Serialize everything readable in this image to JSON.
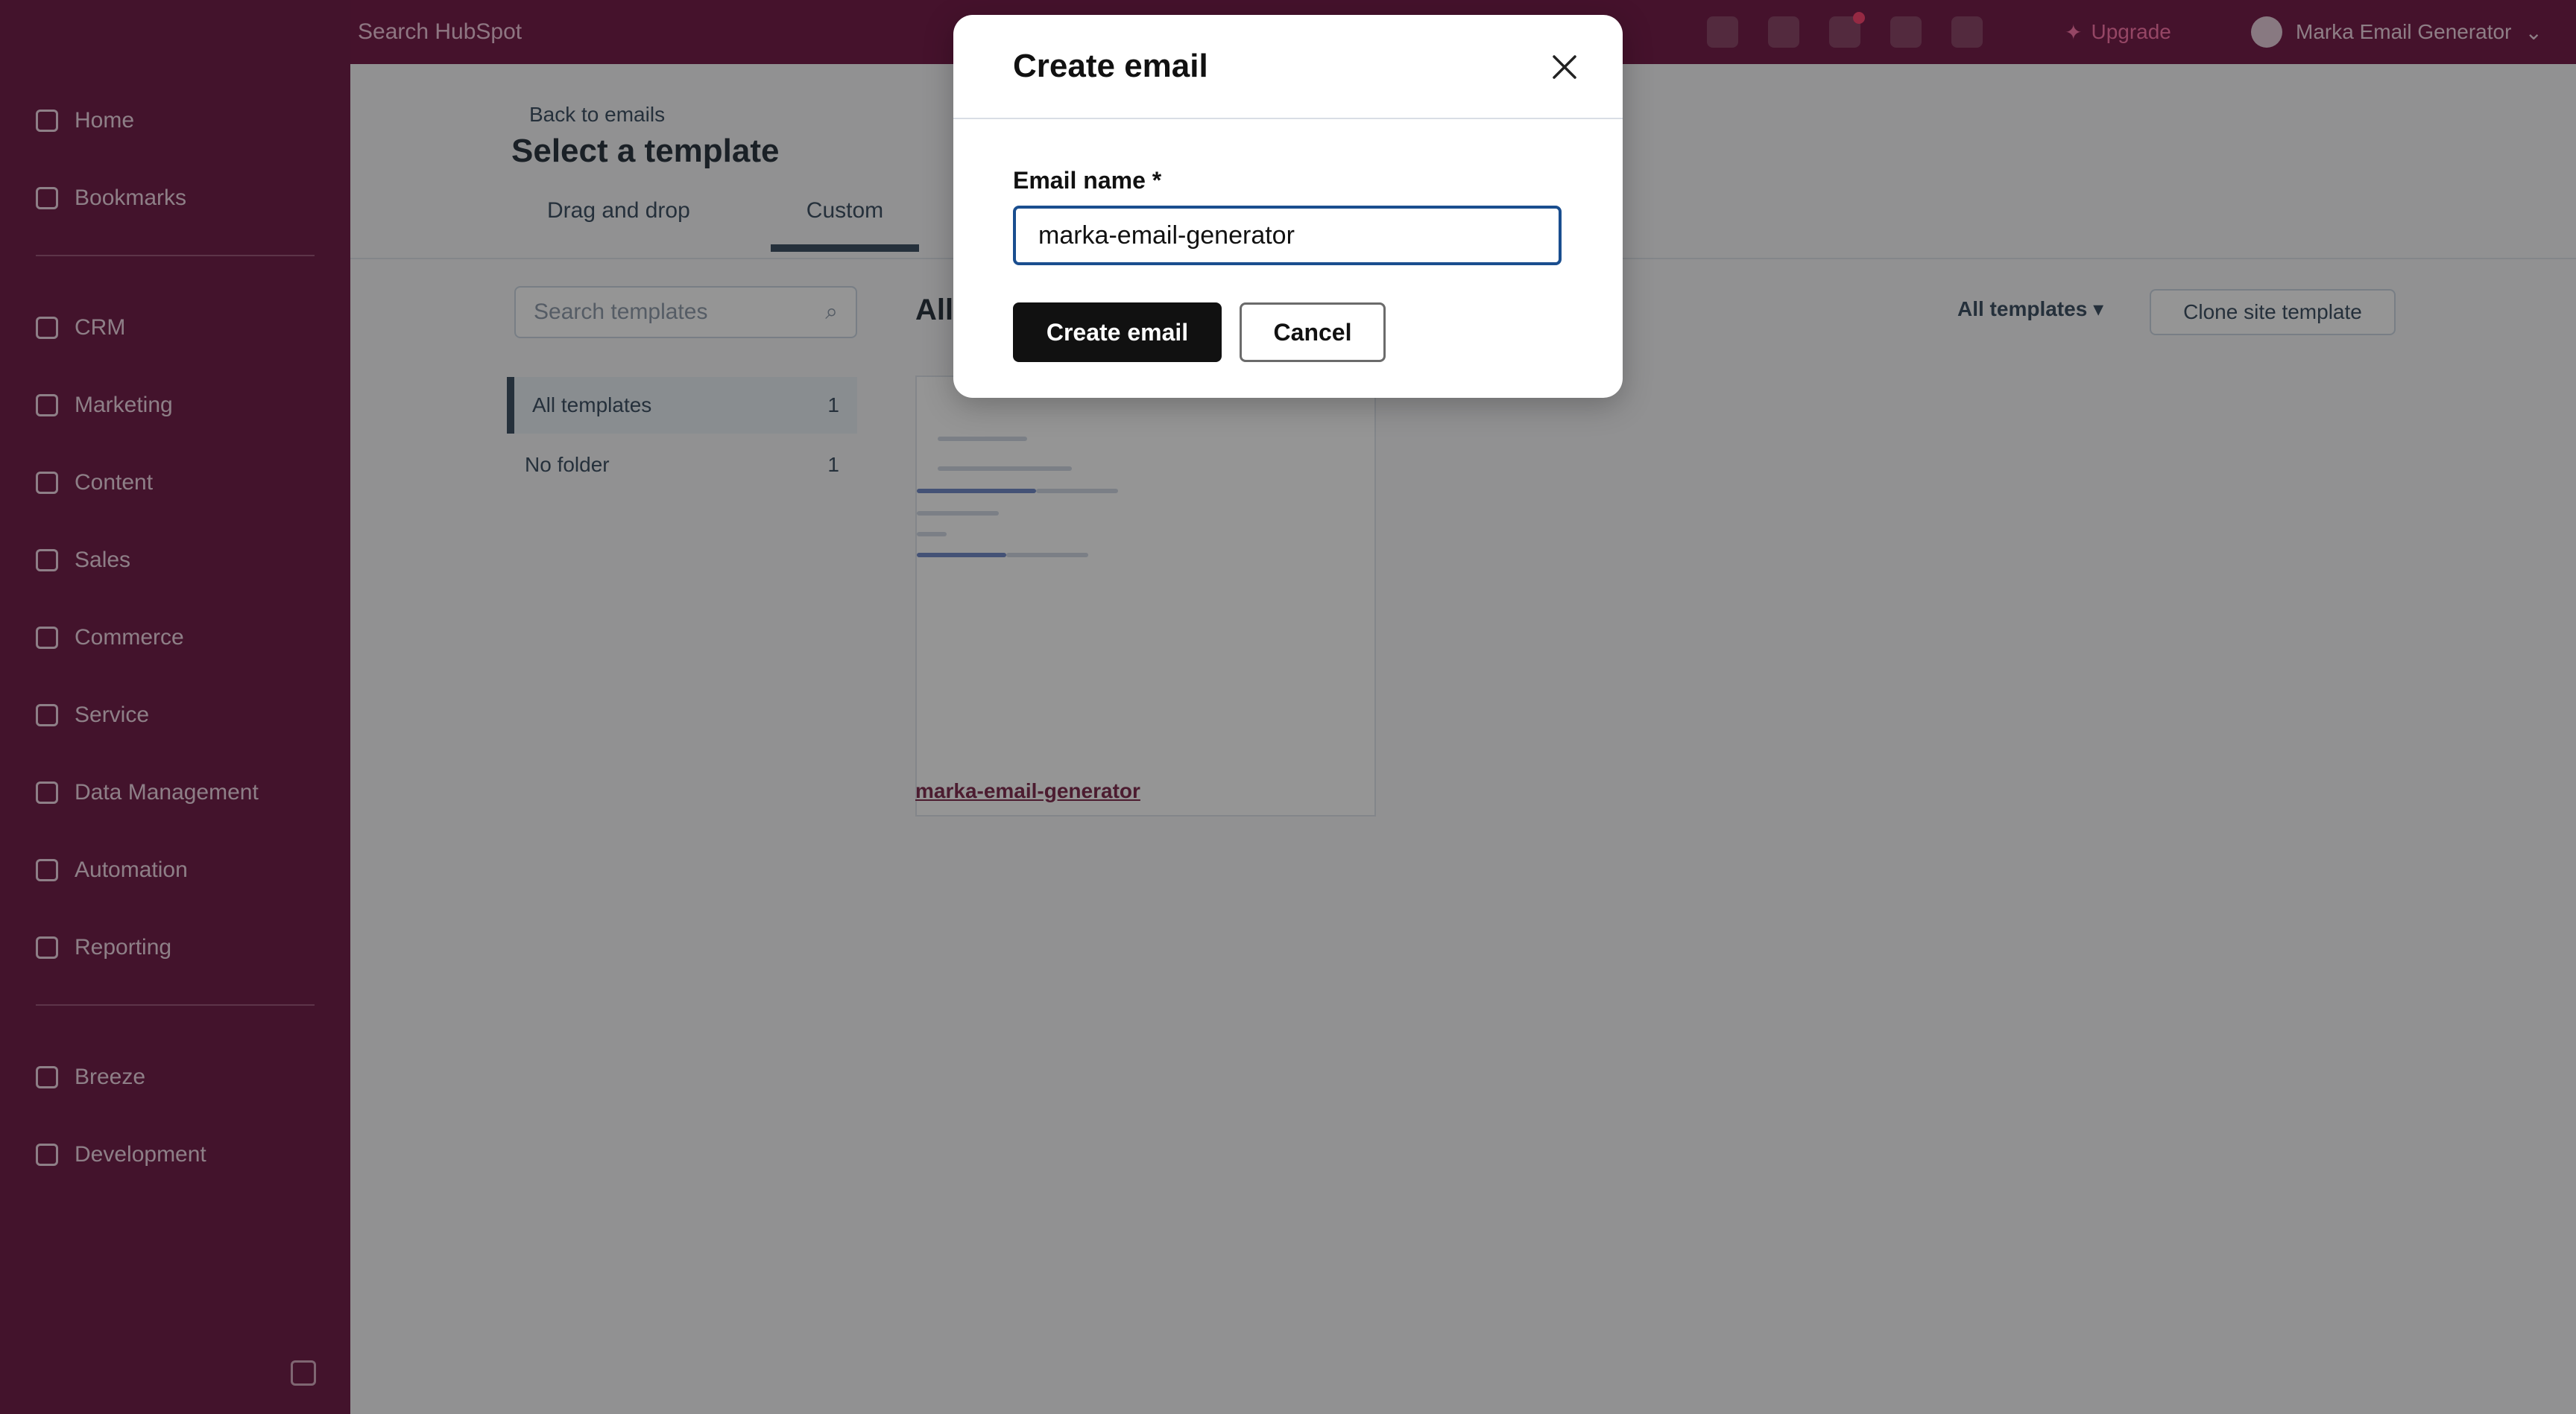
{
  "topbar": {
    "search_placeholder": "Search HubSpot",
    "upgrade_label": "Upgrade",
    "account_name": "Marka Email Generator"
  },
  "sidebar": {
    "items": [
      {
        "label": "Home",
        "icon": "home-icon"
      },
      {
        "label": "Bookmarks",
        "icon": "bookmark-icon"
      },
      {
        "label": "CRM",
        "icon": "crm-icon"
      },
      {
        "label": "Marketing",
        "icon": "marketing-icon"
      },
      {
        "label": "Content",
        "icon": "content-icon"
      },
      {
        "label": "Sales",
        "icon": "sales-icon"
      },
      {
        "label": "Commerce",
        "icon": "commerce-icon"
      },
      {
        "label": "Service",
        "icon": "service-icon"
      },
      {
        "label": "Data Management",
        "icon": "data-icon"
      },
      {
        "label": "Automation",
        "icon": "automation-icon"
      },
      {
        "label": "Reporting",
        "icon": "reporting-icon"
      },
      {
        "label": "Breeze",
        "icon": "breeze-icon"
      },
      {
        "label": "Development",
        "icon": "development-icon"
      }
    ]
  },
  "main": {
    "back_link": "Back to emails",
    "title": "Select a template",
    "tabs": [
      "Drag and drop",
      "Custom"
    ],
    "search_placeholder": "Search templates",
    "categories": [
      {
        "label": "All templates",
        "count": "1"
      },
      {
        "label": "No folder",
        "count": "1"
      }
    ],
    "heading": "All",
    "filter_label": "All templates",
    "import_label": "Clone site template",
    "template_name": "marka-email-generator"
  },
  "modal": {
    "title": "Create email",
    "field_label": "Email name *",
    "field_value": "marka-email-generator",
    "primary_button": "Create email",
    "secondary_button": "Cancel"
  },
  "colors": {
    "sidebar_bg": "#6a1340",
    "primary_button": "#111111",
    "input_focus_border": "#1a4e8f"
  }
}
